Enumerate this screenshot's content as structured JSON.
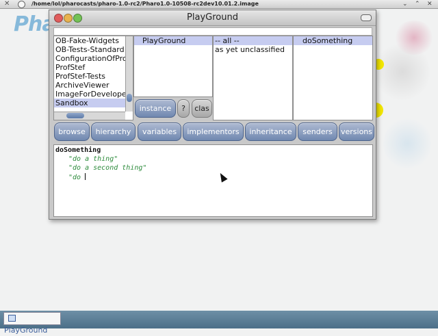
{
  "host": {
    "path": "/home/lol/pharocasts/pharo-1.0-rc2/Pharo1.0-10508-rc2dev10.01.2.image"
  },
  "desktop": {
    "logo_text": "Pha"
  },
  "window": {
    "title": "PlayGround",
    "packages": [
      "OB-Fake-Widgets",
      "OB-Tests-Standard",
      "ConfigurationOfProf",
      "ProfStef",
      "ProfStef-Tests",
      "ArchiveViewer",
      "ImageForDeveloper",
      "Sandbox"
    ],
    "selected_package": "Sandbox",
    "classes": [
      "PlayGround"
    ],
    "categories": [
      "-- all --",
      "as yet unclassified"
    ],
    "methods": [
      "doSomething"
    ],
    "side_buttons": {
      "instance": "instance",
      "help": "?",
      "class": "clas"
    },
    "toolbar": [
      "browse",
      "hierarchy",
      "variables",
      "implementors",
      "inheritance",
      "senders",
      "versions"
    ],
    "code": {
      "method_name": "doSomething",
      "line1": "\"do a thing\"",
      "line2": "\"do a second thing\"",
      "line3": "\"do "
    }
  },
  "taskbar": {
    "item": "PlayGround"
  },
  "colors": {
    "selection": "#c6ccf0",
    "button_blue": "#7088b0",
    "string_green": "#2b8a3a"
  }
}
